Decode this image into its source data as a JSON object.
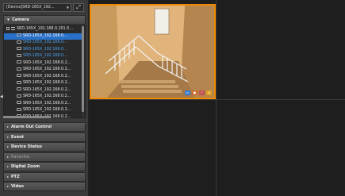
{
  "device": {
    "selected": "[Device]SRD-165X_192...",
    "fullscreen_icon": "expand-icon"
  },
  "camera_section": {
    "label": "Camera"
  },
  "tree": {
    "root_label": "SRD-165X_192.168.0.201:5...",
    "items": [
      {
        "label": "SRD-165X_192.168.0...",
        "state": "selected"
      },
      {
        "label": "SRD-165X_192.168.0...",
        "state": "highlight"
      },
      {
        "label": "SRD-165X_192.168.0...",
        "state": "highlight"
      },
      {
        "label": "SRD-165X_192.168.0...",
        "state": "highlight"
      },
      {
        "label": "SRD-165X_192.168.0.2...",
        "state": "normal"
      },
      {
        "label": "SRD-165X_192.168.0.2...",
        "state": "normal"
      },
      {
        "label": "SRD-165X_192.168.0.2...",
        "state": "normal"
      },
      {
        "label": "SRD-165X_192.168.0.2...",
        "state": "normal"
      },
      {
        "label": "SRD-165X_192.168.0.2...",
        "state": "normal"
      },
      {
        "label": "SRD-165X_192.168.0.2...",
        "state": "normal"
      },
      {
        "label": "SRD-165X_192.168.0.2...",
        "state": "normal"
      },
      {
        "label": "SRD-165X_192.168.0.2...",
        "state": "normal"
      },
      {
        "label": "SRD-165X_192.168.0.2...",
        "state": "normal"
      }
    ]
  },
  "sections": [
    {
      "label": "Alarm Out Control",
      "enabled": true
    },
    {
      "label": "Event",
      "enabled": true
    },
    {
      "label": "Device Status",
      "enabled": true
    },
    {
      "label": "Favorite",
      "enabled": false
    },
    {
      "label": "Digital Zoom",
      "enabled": true
    },
    {
      "label": "PTZ",
      "enabled": true
    },
    {
      "label": "Video",
      "enabled": true
    }
  ],
  "colors": {
    "accent": "#f08a00",
    "selection": "#2870c8",
    "highlight_text": "#4aa3f0"
  },
  "video_toolbar": [
    "screen-icon",
    "record-icon",
    "audio-icon",
    "close-icon"
  ]
}
